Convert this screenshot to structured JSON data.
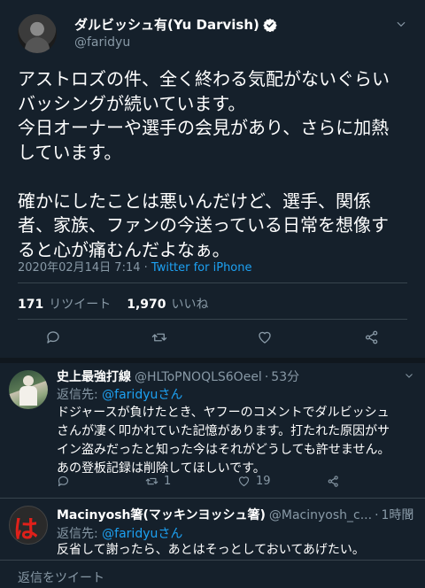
{
  "tweet": {
    "author_name": "ダルビッシュ有(Yu Darvish)",
    "author_handle": "@faridyu",
    "text": "アストロズの件、全く終わる気配がないぐらい\nバッシングが続いています。\n今日オーナーや選手の会見があり、さらに加熱\nしています。\n\n確かにしたことは悪いんだけど、選手、関係\n者、家族、ファンの今送っている日常を想像す\nると心が痛むんだよなぁ。",
    "date": "2020年02月14日 7:14",
    "separator": " · ",
    "client": "Twitter for iPhone",
    "retweets_count": "171",
    "retweets_label": "リツイート",
    "likes_count": "1,970",
    "likes_label": "いいね"
  },
  "replies": [
    {
      "name": "史上最強打線",
      "handle": "@HLToPNOQLS6Oeel",
      "dot": "·",
      "time": "53分",
      "reply_to_label": "返信先: ",
      "reply_to_mention": "@faridyuさん",
      "text": "ドジャースが負けたとき、ヤフーのコメントでダルビッシュ\nさんが凄く叩かれていた記憶があります。打たれた原因がサ\nイン盗みだったと知った今はそれがどうしても許せません。\nあの登板記録は削除してほしいです。",
      "retweets": "1",
      "likes": "19"
    },
    {
      "name": "Macinyosh箸(マッキンヨッシュ箸)",
      "handle": "@Macinyosh_c...",
      "dot": "·",
      "time": "1時間",
      "reply_to_label": "返信先: ",
      "reply_to_mention": "@faridyuさん",
      "text": "反省して謝ったら、あとはそっとしておいてあげたい。",
      "avatar_glyph": "は"
    }
  ],
  "compose": {
    "placeholder": "返信をツイート"
  },
  "colors": {
    "background": "#15202b",
    "accent": "#1da1f2",
    "secondary_text": "#8899a6",
    "divider": "#38444d"
  }
}
